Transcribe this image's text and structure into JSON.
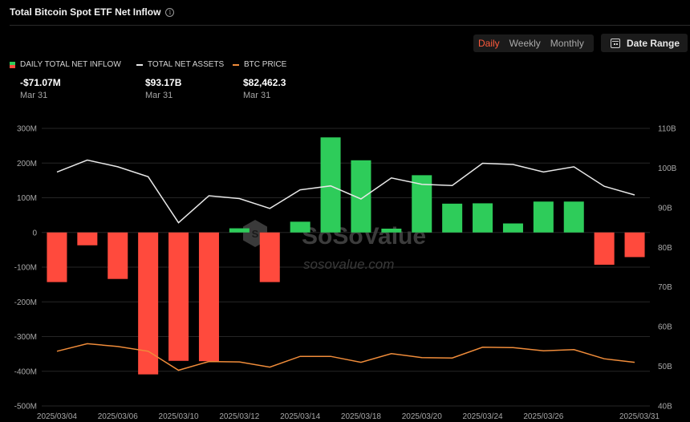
{
  "header": {
    "title": "Total Bitcoin Spot ETF Net Inflow",
    "info_icon": "info-icon"
  },
  "controls": {
    "periods": [
      "Daily",
      "Weekly",
      "Monthly"
    ],
    "active_period": "Daily",
    "date_range_label": "Date Range",
    "date_range_icon": "calendar-icon"
  },
  "colors": {
    "positive": "#2ecc5a",
    "negative": "#ff4a3d",
    "assets_line": "#e8e8e8",
    "btc_line": "#f08c3a",
    "active_period": "#ff5a3c"
  },
  "summary": [
    {
      "label": "DAILY TOTAL NET INFLOW",
      "value": "-$71.07M",
      "date": "Mar 31"
    },
    {
      "label": "TOTAL NET ASSETS",
      "value": "$93.17B",
      "date": "Mar 31"
    },
    {
      "label": "BTC PRICE",
      "value": "$82,462.3",
      "date": "Mar 31"
    }
  ],
  "watermark": {
    "brand": "SoSoValue",
    "url": "sosovalue.com"
  },
  "chart_data": {
    "type": "bar",
    "x": [
      "2025/03/04",
      "2025/03/05",
      "2025/03/06",
      "2025/03/07",
      "2025/03/10",
      "2025/03/11",
      "2025/03/12",
      "2025/03/13",
      "2025/03/14",
      "2025/03/17",
      "2025/03/18",
      "2025/03/19",
      "2025/03/20",
      "2025/03/21",
      "2025/03/24",
      "2025/03/25",
      "2025/03/26",
      "2025/03/27",
      "2025/03/28",
      "2025/03/31"
    ],
    "x_tick_labels": [
      "2025/03/04",
      "2025/03/06",
      "2025/03/10",
      "2025/03/12",
      "2025/03/14",
      "2025/03/18",
      "2025/03/20",
      "2025/03/24",
      "2025/03/26",
      "2025/03/31"
    ],
    "series": [
      {
        "name": "DAILY TOTAL NET INFLOW",
        "type": "bar",
        "axis": "left",
        "values": [
          -143,
          -37,
          -134,
          -409,
          -370,
          -371,
          12,
          -143,
          31,
          274,
          208,
          11,
          165,
          83,
          84,
          26,
          89,
          89,
          -93,
          -71
        ]
      },
      {
        "name": "TOTAL NET ASSETS",
        "type": "line",
        "axis": "right",
        "values": [
          99.0,
          102.0,
          100.3,
          97.8,
          86.2,
          93.0,
          92.3,
          89.8,
          94.5,
          95.5,
          92.2,
          97.5,
          95.9,
          95.6,
          101.2,
          100.9,
          99.0,
          100.3,
          95.4,
          93.2
        ]
      },
      {
        "name": "BTC PRICE",
        "type": "line",
        "axis": "right",
        "values": [
          53.8,
          55.7,
          55.0,
          53.8,
          49.0,
          51.2,
          51.1,
          49.8,
          52.5,
          52.5,
          51.0,
          53.2,
          52.2,
          52.1,
          54.8,
          54.7,
          53.9,
          54.2,
          51.9,
          51.0
        ]
      }
    ],
    "left_axis": {
      "ticks": [
        "300M",
        "200M",
        "100M",
        "0",
        "-100M",
        "-200M",
        "-300M",
        "-400M",
        "-500M"
      ],
      "ylim": [
        -500,
        300
      ],
      "unit": "M"
    },
    "right_axis": {
      "ticks": [
        "110B",
        "100B",
        "90B",
        "80B",
        "70B",
        "60B",
        "50B",
        "40B"
      ],
      "ylim": [
        40,
        110
      ],
      "unit": "B"
    },
    "grid": true
  }
}
